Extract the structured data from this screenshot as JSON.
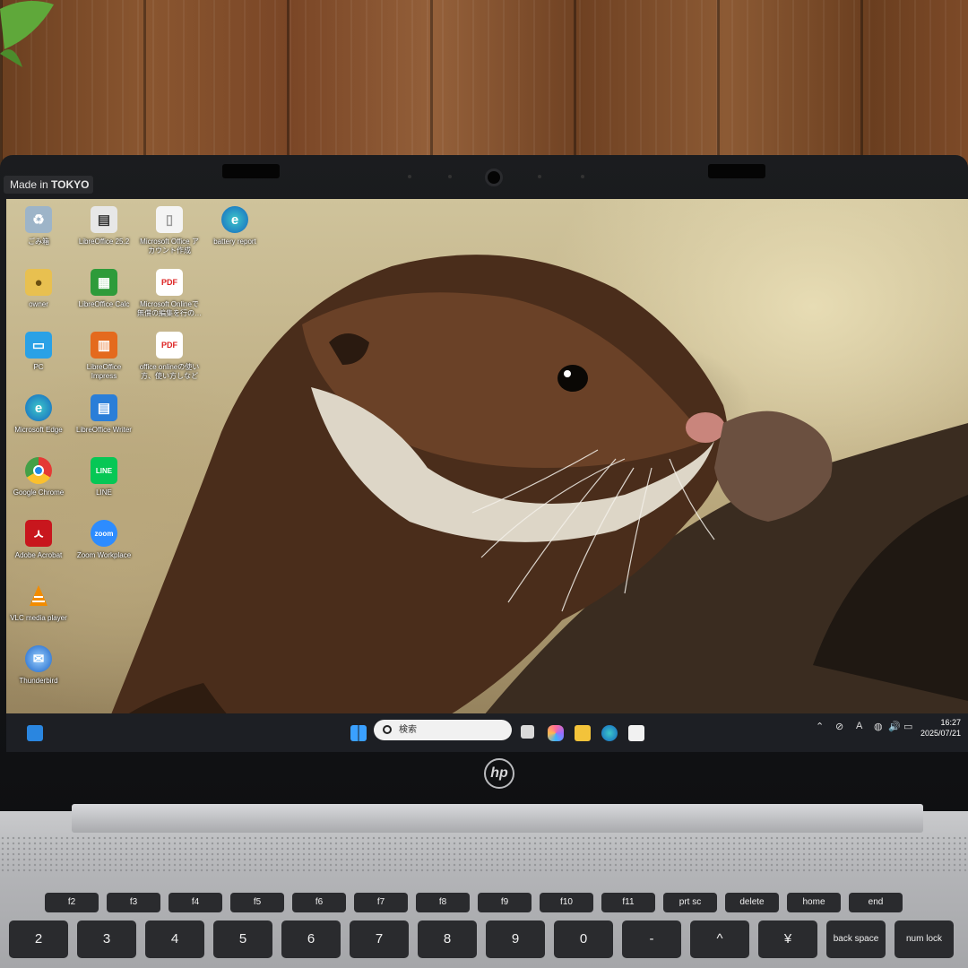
{
  "badge": {
    "prefix": "Made in ",
    "brand": "TOKYO"
  },
  "desktop_icons": [
    {
      "label": "ごみ箱",
      "icon": "recycle-bin-icon"
    },
    {
      "label": "LibreOffice 25.2",
      "icon": "libreoffice-icon"
    },
    {
      "label": "Microsoft Office ア\nカウント作成",
      "icon": "document-icon"
    },
    {
      "label": "battery report",
      "icon": "edge-icon"
    },
    {
      "label": "owner",
      "icon": "user-folder-icon"
    },
    {
      "label": "LibreOffice Calc",
      "icon": "calc-icon"
    },
    {
      "label": "Microsoft Onlineで\n無償の編集を行の…",
      "icon": "pdf-icon"
    },
    {
      "label": "PC",
      "icon": "pc-icon"
    },
    {
      "label": "LibreOffice\nImpress",
      "icon": "impress-icon"
    },
    {
      "label": "office onlineの使い\n方、使い方しなど",
      "icon": "pdf-icon"
    },
    {
      "label": "Microsoft Edge",
      "icon": "edge-icon"
    },
    {
      "label": "LibreOffice Writer",
      "icon": "writer-icon"
    },
    {
      "label": "Google Chrome",
      "icon": "chrome-icon"
    },
    {
      "label": "LINE",
      "icon": "line-icon"
    },
    {
      "label": "Adobe Acrobat",
      "icon": "acrobat-icon"
    },
    {
      "label": "Zoom Workplace",
      "icon": "zoom-icon"
    },
    {
      "label": "VLC media player",
      "icon": "vlc-icon"
    },
    {
      "label": "Thunderbird",
      "icon": "thunderbird-icon"
    }
  ],
  "taskbar": {
    "search_placeholder": "検索",
    "time": "16:27",
    "date": "2025/07/21",
    "ime": "A",
    "pinned": [
      "start-icon",
      "task-view-icon",
      "copilot-icon",
      "file-explorer-icon",
      "edge-icon",
      "store-icon"
    ]
  },
  "logo": "hp",
  "keys_top": [
    "f2",
    "f3",
    "f4",
    "f5",
    "f6",
    "f7",
    "f8",
    "f9",
    "f10",
    "f11",
    "prt sc",
    "delete",
    "home",
    "end"
  ],
  "keys_num": [
    "2",
    "3",
    "4",
    "5",
    "6",
    "7",
    "8",
    "9",
    "0",
    "-",
    "^",
    "¥",
    "back space",
    "num lock"
  ],
  "colors": {
    "taskbar": "#1d1f24",
    "bezel": "#131417",
    "accent": "#0078d4"
  }
}
